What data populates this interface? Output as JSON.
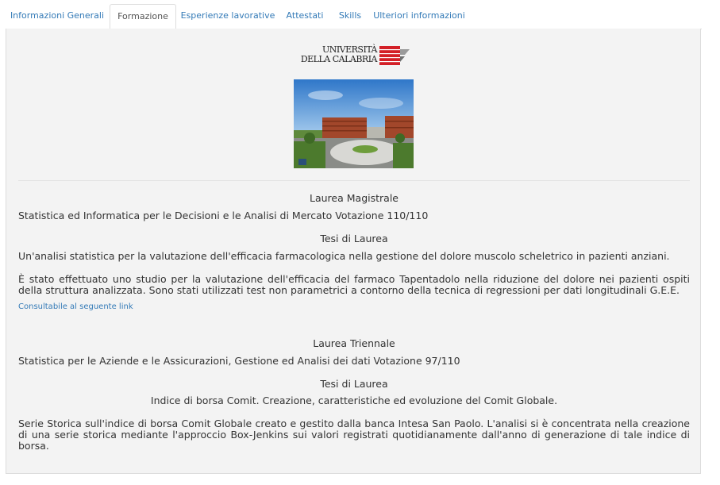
{
  "tabs": [
    {
      "label": "Informazioni Generali",
      "active": false
    },
    {
      "label": "Formazione",
      "active": true
    },
    {
      "label": "Esperienze lavorative",
      "active": false
    },
    {
      "label": "Attestati",
      "active": false
    },
    {
      "label": "Skills",
      "active": false
    },
    {
      "label": "Ulteriori informazioni",
      "active": false
    }
  ],
  "logo": {
    "line1": "UNIVERSITÀ",
    "line2": "DELLA CALABRIA",
    "color": "#d32027"
  },
  "photo": {
    "sky_color": "#4a8fd6",
    "building_color": "#a2472b"
  },
  "laurea_magistrale": {
    "heading": "Laurea Magistrale",
    "course": "Statistica ed Informatica per le Decisioni e le Analisi di Mercato Votazione 110/110",
    "thesis_heading": "Tesi di Laurea",
    "thesis_title": "Un'analisi statistica per la valutazione dell'efficacia farmacologica nella gestione del dolore muscolo scheletrico in pazienti anziani.",
    "description": "È stato effettuato uno studio per la valutazione dell'efficacia del farmaco Tapentadolo nella riduzione del dolore nei pazienti ospiti della struttura analizzata. Sono stati utilizzati test non parametrici a contorno della tecnica di regressioni per dati longitudinali G.E.E.",
    "link_label": "Consultabile al seguente link"
  },
  "laurea_triennale": {
    "heading": "Laurea Triennale",
    "course": "Statistica per le Aziende e le Assicurazioni, Gestione ed Analisi dei dati Votazione 97/110",
    "thesis_heading": "Tesi di Laurea",
    "thesis_title": "Indice di borsa Comit. Creazione, caratteristiche ed evoluzione del Comit Globale.",
    "description": "Serie Storica sull'indice di borsa Comit Globale creato e gestito dalla banca Intesa San Paolo. L'analisi si è concentrata nella creazione di una serie storica mediante l'approccio Box-Jenkins sui valori registrati quotidianamente dall'anno di generazione di tale indice di borsa."
  }
}
